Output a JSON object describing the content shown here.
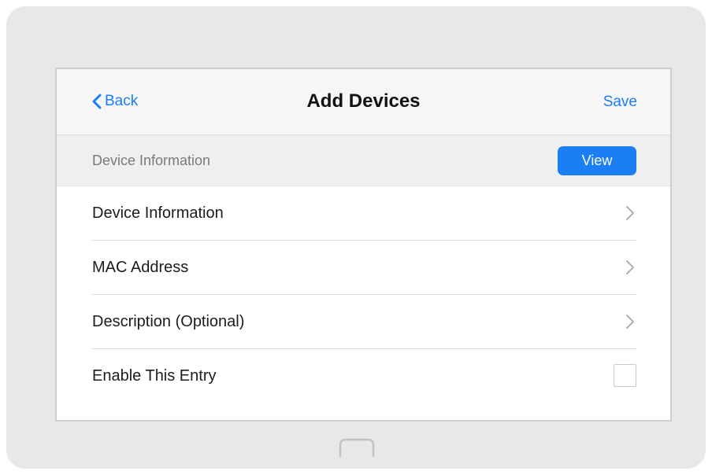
{
  "navbar": {
    "back_label": "Back",
    "title": "Add Devices",
    "save_label": "Save"
  },
  "section": {
    "title": "Device Information",
    "view_label": "View"
  },
  "rows": [
    {
      "label": "Device Information",
      "control": "chevron"
    },
    {
      "label": "MAC Address",
      "control": "chevron"
    },
    {
      "label": "Description (Optional)",
      "control": "chevron"
    },
    {
      "label": "Enable This Entry",
      "control": "checkbox",
      "checked": false
    }
  ],
  "colors": {
    "accent": "#1b7ef5",
    "frame": "#e8e8e8",
    "section_bg": "#efeff2",
    "navbar_bg": "#f6f6f6"
  },
  "icons": {
    "back": "chevron-left-icon",
    "row_action": "chevron-right-icon",
    "home": "home-button-icon"
  }
}
